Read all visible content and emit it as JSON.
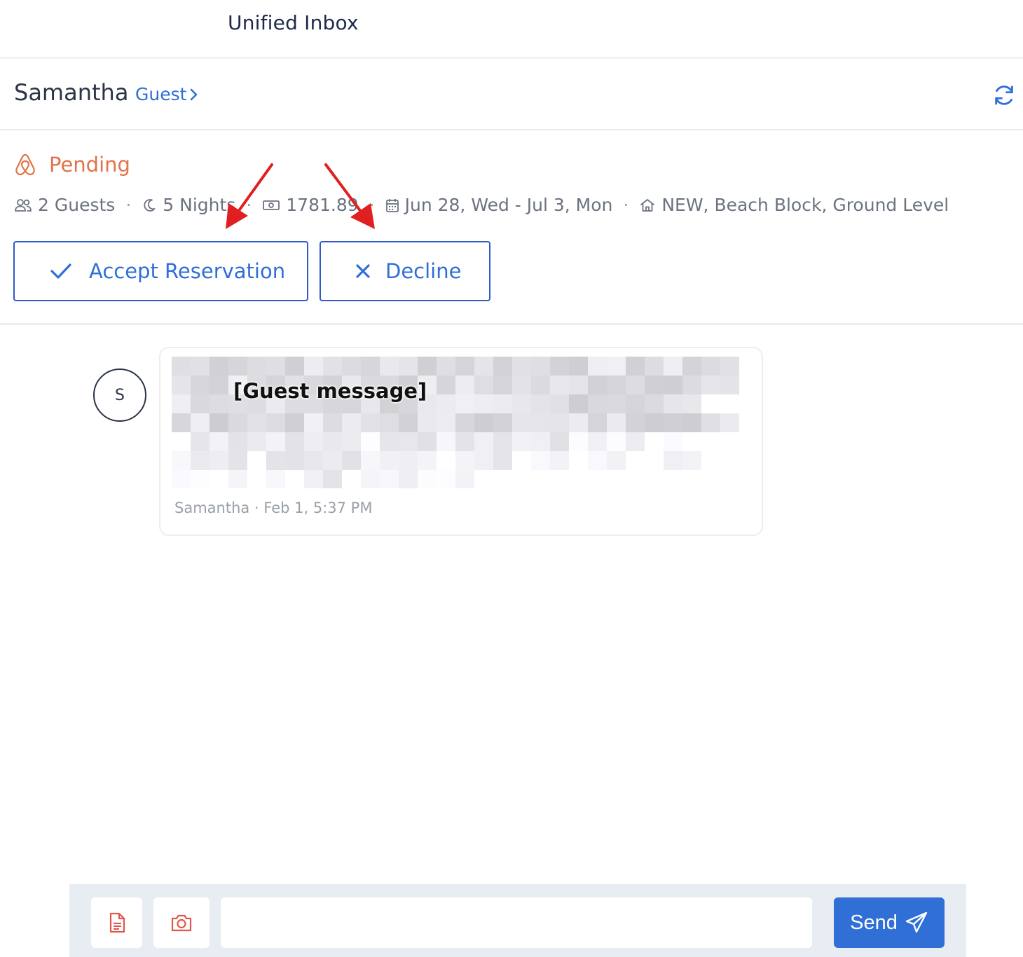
{
  "app": {
    "title": "Unified Inbox"
  },
  "guest": {
    "name": "Samantha",
    "link_label": "Guest"
  },
  "reservation": {
    "status": "Pending",
    "guests": "2 Guests",
    "nights": "5 Nights",
    "amount": "1781.89",
    "dates": "Jun 28, Wed - Jul 3, Mon",
    "property": "NEW, Beach Block, Ground Level",
    "separator": "·",
    "accept_label": "Accept Reservation",
    "decline_label": "Decline"
  },
  "message": {
    "avatar_initial": "S",
    "placeholder_label": "[Guest message]",
    "meta": "Samantha · Feb 1, 5:37 PM"
  },
  "composer": {
    "input_value": "",
    "send_label": "Send"
  },
  "colors": {
    "accent": "#2f6fd6",
    "pending": "#e0744a",
    "annotation": "#e02020"
  },
  "icons": [
    "refresh-icon",
    "airbnb-icon",
    "users-icon",
    "moon-icon",
    "cash-icon",
    "calendar-icon",
    "home-icon",
    "check-icon",
    "x-icon",
    "document-icon",
    "camera-icon",
    "send-icon"
  ]
}
